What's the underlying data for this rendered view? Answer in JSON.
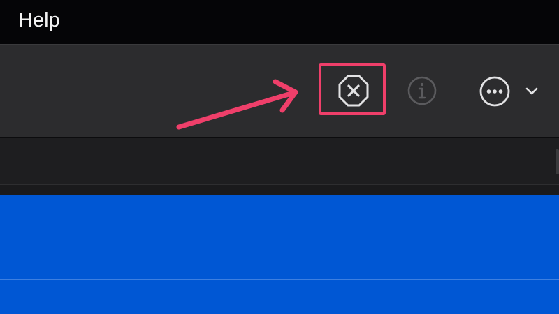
{
  "menubar": {
    "help_label": "Help"
  },
  "toolbar": {
    "icons": [
      "stop-icon",
      "info-icon",
      "more-icon",
      "chevron-down-icon"
    ]
  },
  "annotation": {
    "highlight_color": "#ef3f6a",
    "arrow_color": "#ef3f6a"
  },
  "colors": {
    "menubar_bg": "#050507",
    "toolbar_bg": "#2c2c2e",
    "selection_bg": "#0057d4"
  }
}
